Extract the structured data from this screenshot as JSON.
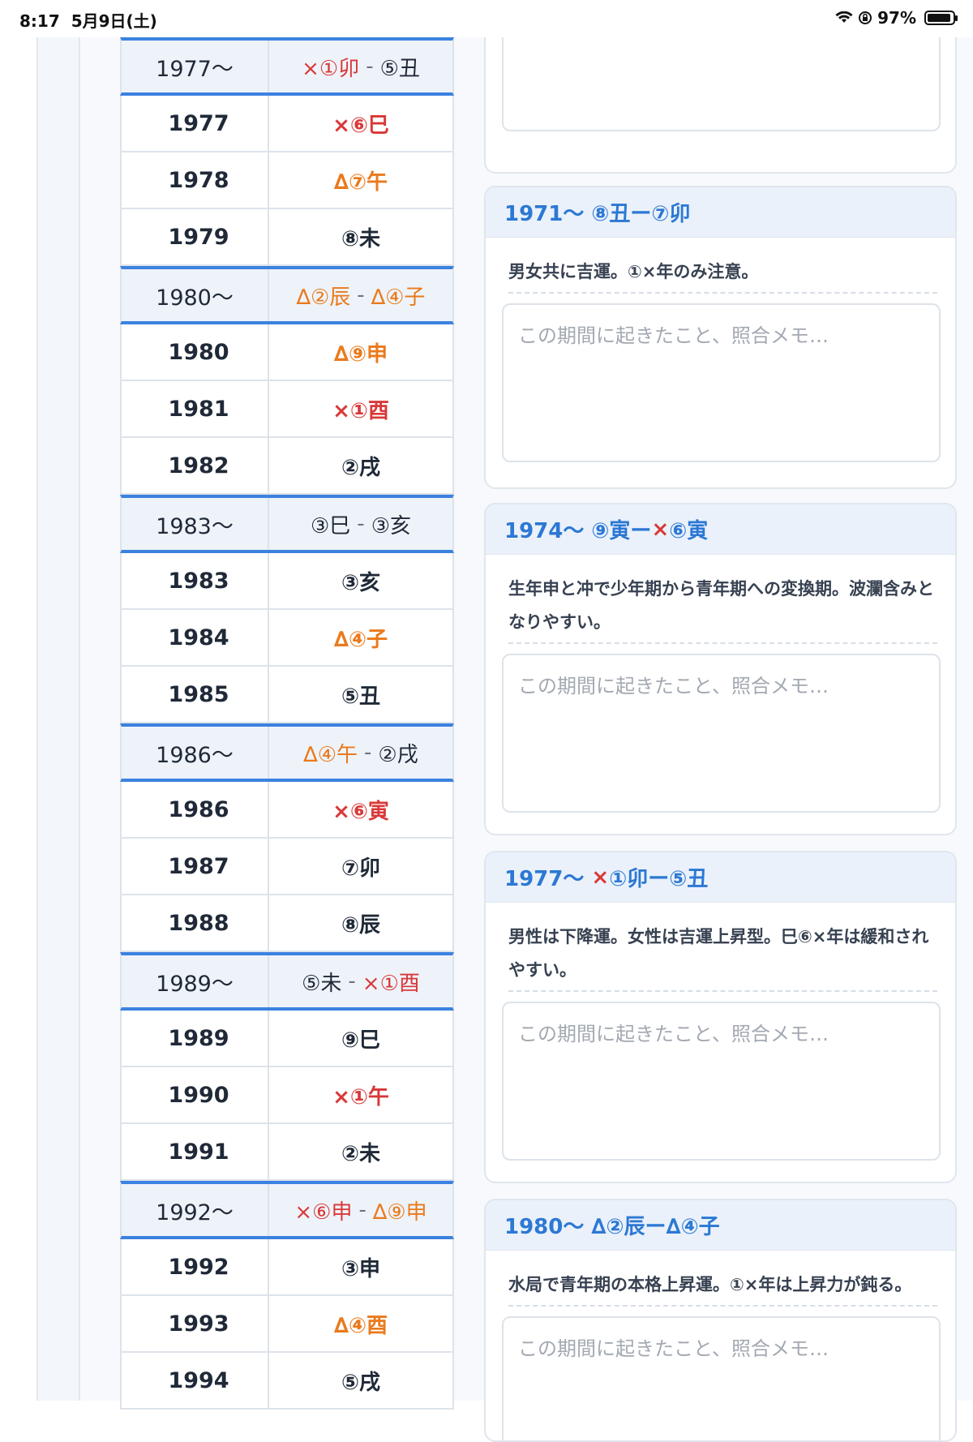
{
  "status_bar": {
    "time": "8:17",
    "date": "5月9日(土)",
    "battery": "97%"
  },
  "table_rows": [
    {
      "type": "group",
      "year": "1977〜",
      "parts": [
        {
          "t": "×①卯",
          "c": "red"
        },
        {
          "t": "⑤丑",
          "c": "dark"
        }
      ]
    },
    {
      "type": "row",
      "year": "1977",
      "parts": [
        {
          "t": "×⑥巳",
          "c": "red"
        }
      ]
    },
    {
      "type": "row",
      "year": "1978",
      "parts": [
        {
          "t": "∆⑦午",
          "c": "orange"
        }
      ]
    },
    {
      "type": "row",
      "year": "1979",
      "parts": [
        {
          "t": "⑧未",
          "c": "dark"
        }
      ]
    },
    {
      "type": "group",
      "year": "1980〜",
      "parts": [
        {
          "t": "∆②辰",
          "c": "orange"
        },
        {
          "t": "∆④子",
          "c": "orange"
        }
      ]
    },
    {
      "type": "row",
      "year": "1980",
      "parts": [
        {
          "t": "∆⑨申",
          "c": "orange"
        }
      ]
    },
    {
      "type": "row",
      "year": "1981",
      "parts": [
        {
          "t": "×①酉",
          "c": "red"
        }
      ]
    },
    {
      "type": "row",
      "year": "1982",
      "parts": [
        {
          "t": "②戌",
          "c": "dark"
        }
      ]
    },
    {
      "type": "group",
      "year": "1983〜",
      "parts": [
        {
          "t": "③巳",
          "c": "dark"
        },
        {
          "t": "③亥",
          "c": "dark"
        }
      ]
    },
    {
      "type": "row",
      "year": "1983",
      "parts": [
        {
          "t": "③亥",
          "c": "dark"
        }
      ]
    },
    {
      "type": "row",
      "year": "1984",
      "parts": [
        {
          "t": "∆④子",
          "c": "orange"
        }
      ]
    },
    {
      "type": "row",
      "year": "1985",
      "parts": [
        {
          "t": "⑤丑",
          "c": "dark"
        }
      ]
    },
    {
      "type": "group",
      "year": "1986〜",
      "parts": [
        {
          "t": "∆④午",
          "c": "orange"
        },
        {
          "t": "②戌",
          "c": "dark"
        }
      ]
    },
    {
      "type": "row",
      "year": "1986",
      "parts": [
        {
          "t": "×⑥寅",
          "c": "red"
        }
      ]
    },
    {
      "type": "row",
      "year": "1987",
      "parts": [
        {
          "t": "⑦卯",
          "c": "dark"
        }
      ]
    },
    {
      "type": "row",
      "year": "1988",
      "parts": [
        {
          "t": "⑧辰",
          "c": "dark"
        }
      ]
    },
    {
      "type": "group",
      "year": "1989〜",
      "parts": [
        {
          "t": "⑤未",
          "c": "dark"
        },
        {
          "t": "×①酉",
          "c": "red"
        }
      ]
    },
    {
      "type": "row",
      "year": "1989",
      "parts": [
        {
          "t": "⑨巳",
          "c": "dark"
        }
      ]
    },
    {
      "type": "row",
      "year": "1990",
      "parts": [
        {
          "t": "×①午",
          "c": "red"
        }
      ]
    },
    {
      "type": "row",
      "year": "1991",
      "parts": [
        {
          "t": "②未",
          "c": "dark"
        }
      ]
    },
    {
      "type": "group",
      "year": "1992〜",
      "parts": [
        {
          "t": "×⑥申",
          "c": "red"
        },
        {
          "t": "∆⑨申",
          "c": "orange"
        }
      ]
    },
    {
      "type": "row",
      "year": "1992",
      "parts": [
        {
          "t": "③申",
          "c": "dark"
        }
      ]
    },
    {
      "type": "row",
      "year": "1993",
      "parts": [
        {
          "t": "∆④酉",
          "c": "orange"
        }
      ]
    },
    {
      "type": "row",
      "year": "1994",
      "parts": [
        {
          "t": "⑤戌",
          "c": "dark"
        }
      ]
    }
  ],
  "table_separator": "-",
  "memo_placeholder": "この期間に起きたこと、照合メモ…",
  "cards": [
    {
      "heading": [
        {
          "t": "1971〜 ",
          "c": "blue"
        },
        {
          "t": "⑧丑ー⑦卯",
          "c": "blue"
        }
      ],
      "description": "男女共に吉運。①×年のみ注意。"
    },
    {
      "heading": [
        {
          "t": "1974〜 ",
          "c": "blue"
        },
        {
          "t": "⑨寅ー",
          "c": "blue"
        },
        {
          "t": "×",
          "c": "red"
        },
        {
          "t": "⑥寅",
          "c": "blue"
        }
      ],
      "description": "生年申と冲で少年期から青年期への変換期。波瀾含みとなりやすい。"
    },
    {
      "heading": [
        {
          "t": "1977〜 ",
          "c": "blue"
        },
        {
          "t": "×",
          "c": "red"
        },
        {
          "t": "①卯ー⑤丑",
          "c": "blue"
        }
      ],
      "description": "男性は下降運。女性は吉運上昇型。巳⑥×年は緩和されやすい。"
    },
    {
      "heading": [
        {
          "t": "1980〜 ",
          "c": "blue"
        },
        {
          "t": "∆②辰ー∆④子",
          "c": "blue"
        }
      ],
      "description": "水局で青年期の本格上昇運。①×年は上昇力が鈍る。"
    }
  ]
}
